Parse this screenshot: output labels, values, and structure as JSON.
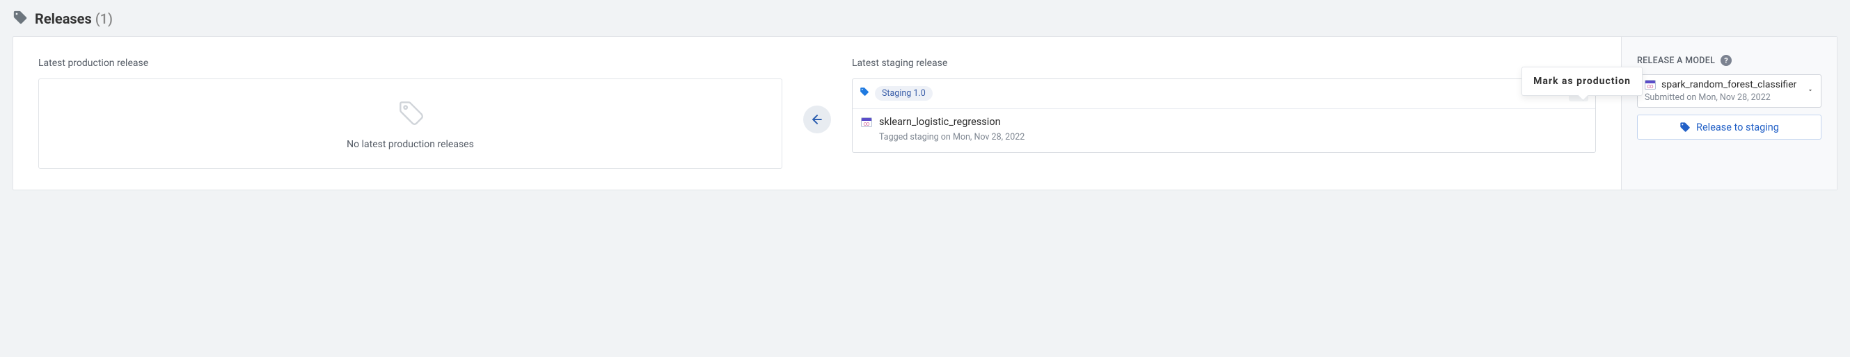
{
  "header": {
    "title": "Releases",
    "count": "(1)"
  },
  "production": {
    "label": "Latest production release",
    "empty_text": "No latest production releases"
  },
  "staging": {
    "label": "Latest staging release",
    "pill": "Staging 1.0",
    "model_name": "sklearn_logistic_regression",
    "sub": "Tagged staging on Mon, Nov 28, 2022",
    "tooltip": "Mark as production"
  },
  "sidebar": {
    "header": "Release a model",
    "selected_model": "spark_random_forest_classifier",
    "selected_sub": "Submitted on Mon, Nov 28, 2022",
    "button": "Release to staging"
  }
}
